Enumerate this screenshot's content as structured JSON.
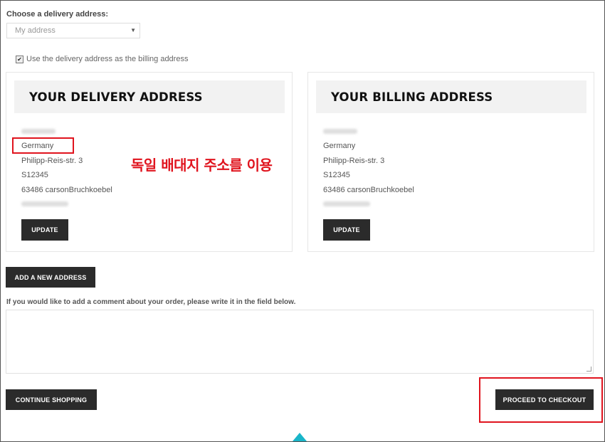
{
  "delivery": {
    "label": "Choose a delivery address:",
    "select_value": "My address",
    "use_as_billing_label": "Use the delivery address as the billing address",
    "use_as_billing_checked": true
  },
  "delivery_card": {
    "title": "YOUR DELIVERY ADDRESS",
    "country": "Germany",
    "street": "Philipp-Reis-str. 3",
    "line3": "S12345",
    "city_line": "63486 carsonBruchkoebel",
    "update_label": "UPDATE"
  },
  "billing_card": {
    "title": "YOUR BILLING ADDRESS",
    "country": "Germany",
    "street": "Philipp-Reis-str. 3",
    "line3": "S12345",
    "city_line": "63486 carsonBruchkoebel",
    "update_label": "UPDATE"
  },
  "annotation": {
    "text": "독일 배대지 주소를 이용",
    "color": "#e0141e"
  },
  "add_address_label": "ADD A NEW ADDRESS",
  "comment": {
    "label": "If you would like to add a comment about your order, please write it in the field below.",
    "value": ""
  },
  "continue_label": "CONTINUE SHOPPING",
  "checkout_label": "PROCEED TO CHECKOUT",
  "colors": {
    "button": "#2b2b2b",
    "card_header": "#f2f2f2",
    "annotation": "#e0141e",
    "scroll_marker": "#19b5c9"
  }
}
